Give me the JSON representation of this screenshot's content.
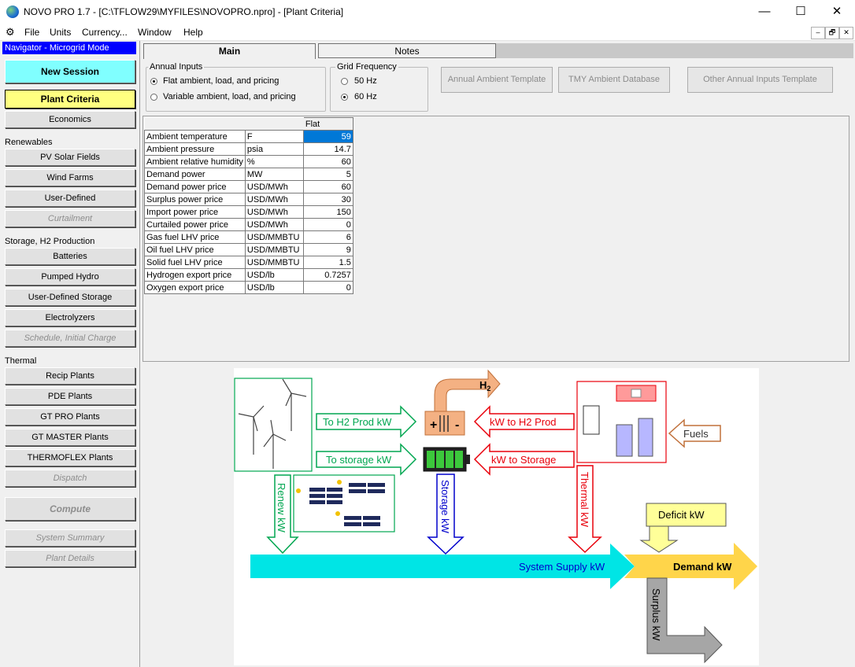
{
  "window": {
    "title": "NOVO PRO 1.7 - [C:\\TFLOW29\\MYFILES\\NOVOPRO.npro] - [Plant Criteria]",
    "minimize": "—",
    "maximize": "☐",
    "close": "✕"
  },
  "menu": {
    "items": [
      "File",
      "Units",
      "Currency...",
      "Window",
      "Help"
    ],
    "mdi": [
      "–",
      "🗗",
      "✕"
    ]
  },
  "navigator": {
    "header": "Navigator - Microgrid Mode",
    "new_session": "New Session",
    "plant_criteria": "Plant Criteria",
    "economics": "Economics",
    "renewables_label": "Renewables",
    "pv_solar": "PV Solar Fields",
    "wind_farms": "Wind Farms",
    "user_defined": "User-Defined",
    "curtailment": "Curtailment",
    "storage_label": "Storage, H2 Production",
    "batteries": "Batteries",
    "pumped_hydro": "Pumped Hydro",
    "user_defined_storage": "User-Defined Storage",
    "electrolyzers": "Electrolyzers",
    "schedule": "Schedule, Initial Charge",
    "thermal_label": "Thermal",
    "recip": "Recip Plants",
    "pde": "PDE Plants",
    "gt_pro": "GT PRO Plants",
    "gt_master": "GT MASTER Plants",
    "thermoflex": "THERMOFLEX Plants",
    "dispatch": "Dispatch",
    "compute": "Compute",
    "system_summary": "System Summary",
    "plant_details": "Plant Details"
  },
  "tabs": {
    "main": "Main",
    "notes": "Notes"
  },
  "annual_inputs": {
    "title": "Annual Inputs",
    "opt_flat": "Flat ambient, load, and pricing",
    "opt_variable": "Variable ambient, load, and pricing",
    "selected": "flat"
  },
  "grid_frequency": {
    "title": "Grid Frequency",
    "opt_50": "50 Hz",
    "opt_60": "60 Hz",
    "selected": "60"
  },
  "templates": {
    "annual_ambient": "Annual Ambient Template",
    "tmy": "TMY Ambient Database",
    "other": "Other Annual Inputs Template"
  },
  "grid": {
    "column": "Flat",
    "rows": [
      {
        "label": "Ambient temperature",
        "unit": "F",
        "value": "59"
      },
      {
        "label": "Ambient pressure",
        "unit": "psia",
        "value": "14.7"
      },
      {
        "label": "Ambient relative humidity",
        "unit": "%",
        "value": "60"
      },
      {
        "label": "Demand power",
        "unit": "MW",
        "value": "5"
      },
      {
        "label": "Demand power price",
        "unit": "USD/MWh",
        "value": "60"
      },
      {
        "label": "Surplus power price",
        "unit": "USD/MWh",
        "value": "30"
      },
      {
        "label": "Import power price",
        "unit": "USD/MWh",
        "value": "150"
      },
      {
        "label": "Curtailed power price",
        "unit": "USD/MWh",
        "value": "0"
      },
      {
        "label": "Gas fuel LHV price",
        "unit": "USD/MMBTU",
        "value": "6"
      },
      {
        "label": "Oil fuel LHV price",
        "unit": "USD/MMBTU",
        "value": "9"
      },
      {
        "label": "Solid fuel LHV price",
        "unit": "USD/MMBTU",
        "value": "1.5"
      },
      {
        "label": "Hydrogen export price",
        "unit": "USD/lb",
        "value": "0.7257"
      },
      {
        "label": "Oxygen export price",
        "unit": "USD/lb",
        "value": "0"
      }
    ]
  },
  "diagram": {
    "h2": "H",
    "h2_sub": "2",
    "to_h2_prod": "To H2 Prod kW",
    "to_storage": "To storage kW",
    "kw_to_h2_prod": "kW to H2 Prod",
    "kw_to_storage": "kW to Storage",
    "fuels": "Fuels",
    "renew": "Renew kW",
    "storage": "Storage kW",
    "thermal": "Thermal kW",
    "deficit": "Deficit kW",
    "system_supply": "System Supply kW",
    "demand": "Demand kW",
    "surplus": "Surplus kW",
    "plus": "+",
    "minus": "-",
    "colors": {
      "green": "#00a650",
      "red": "#e8000b",
      "blue": "#0000cc",
      "orange": "#f4a460",
      "cyan": "#00e5e5",
      "gold": "#ffd54a",
      "gray": "#a6a6a6",
      "navy": "#1f2a5c"
    }
  }
}
